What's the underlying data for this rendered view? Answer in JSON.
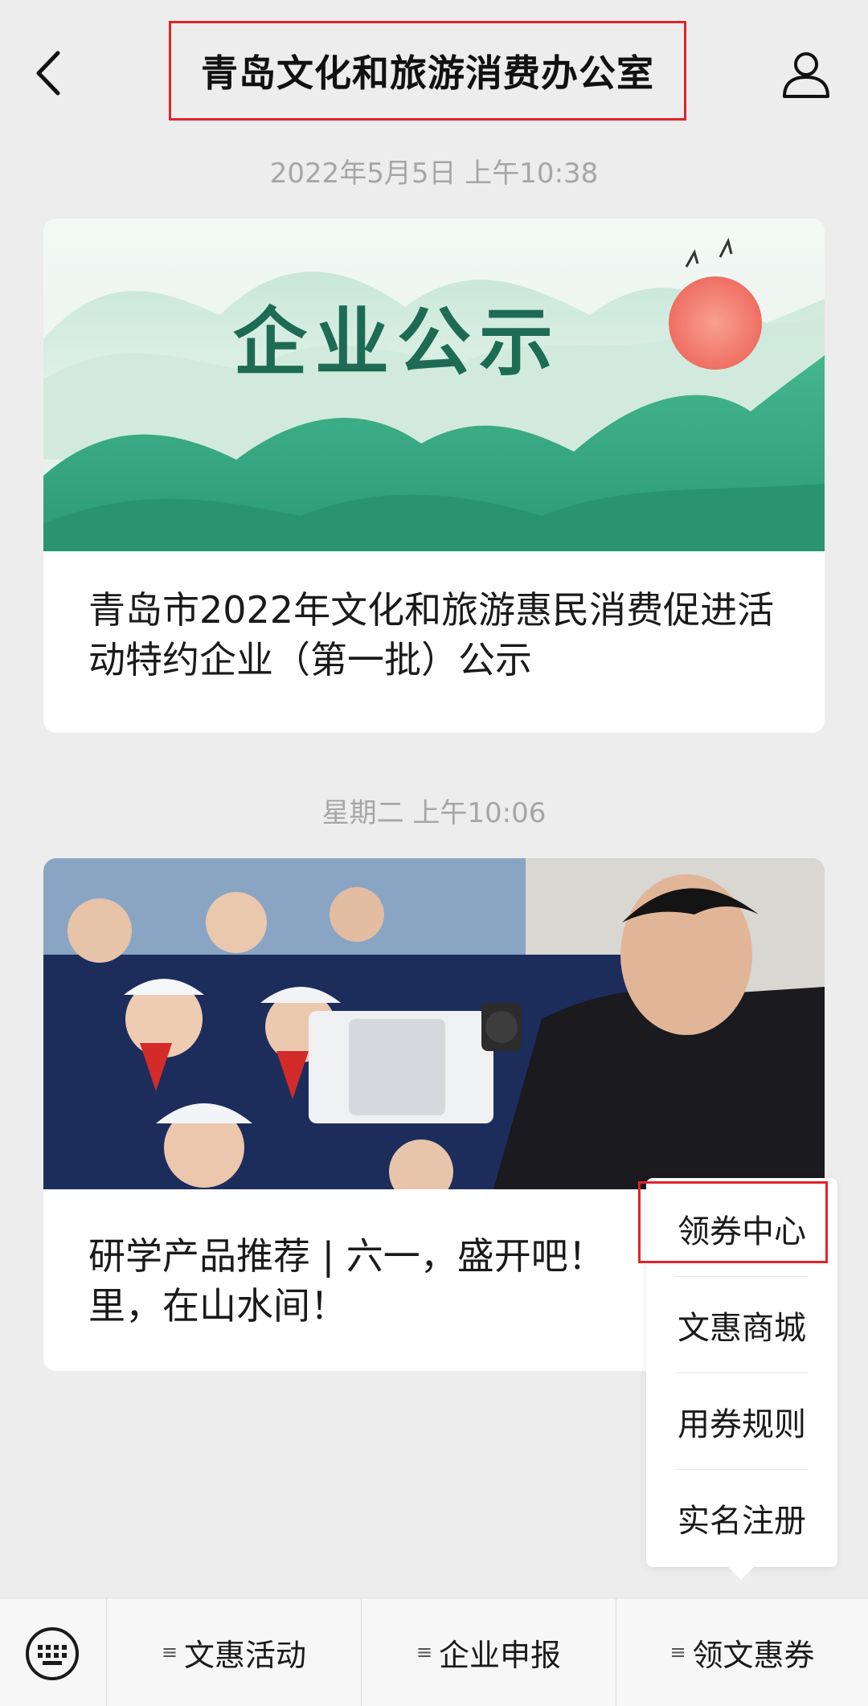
{
  "header": {
    "title": "青岛文化和旅游消费办公室",
    "back_icon": "back-chevron-icon",
    "profile_icon": "profile-icon"
  },
  "messages": [
    {
      "timestamp": "2022年5月5日 上午10:38",
      "banner_text": "企业公示",
      "title": "青岛市2022年文化和旅游惠民消费促进活动特约企业（第一批）公示"
    },
    {
      "timestamp": "星期二 上午10:06",
      "title": "研学产品推荐 | 六一，盛开吧！里，在山水间！"
    }
  ],
  "popup_menu": {
    "items": [
      "领券中心",
      "文惠商城",
      "用券规则",
      "实名注册"
    ]
  },
  "bottom_menu": {
    "keyboard_icon": "keyboard-icon",
    "items": [
      "文惠活动",
      "企业申报",
      "领文惠券"
    ]
  },
  "colors": {
    "background": "#ededed",
    "highlight": "#e0242b",
    "banner_green": "#2fa984",
    "banner_sun": "#f0776a"
  }
}
